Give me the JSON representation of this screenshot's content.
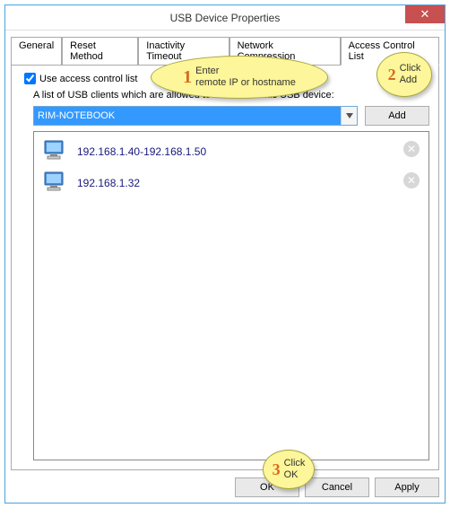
{
  "window": {
    "title": "USB Device Properties",
    "close_label": "✕"
  },
  "tabs": {
    "items": [
      "General",
      "Reset Method",
      "Inactivity Timeout",
      "Network Compression",
      "Access Control List"
    ],
    "active": 4
  },
  "acl": {
    "checkbox_label": "Use access control list",
    "checked": true,
    "description": "A list of USB clients which are allowed to connect to this USB device:",
    "input_value": "RIM-NOTEBOOK",
    "add_button": "Add",
    "entries": [
      "192.168.1.40-192.168.1.50",
      "192.168.1.32"
    ]
  },
  "buttons": {
    "ok": "OK",
    "cancel": "Cancel",
    "apply": "Apply"
  },
  "callouts": {
    "c1_num": "1",
    "c1_text": "Enter\nremote IP or hostname",
    "c2_num": "2",
    "c2_text": "Click\nAdd",
    "c3_num": "3",
    "c3_text": "Click\nOK"
  }
}
